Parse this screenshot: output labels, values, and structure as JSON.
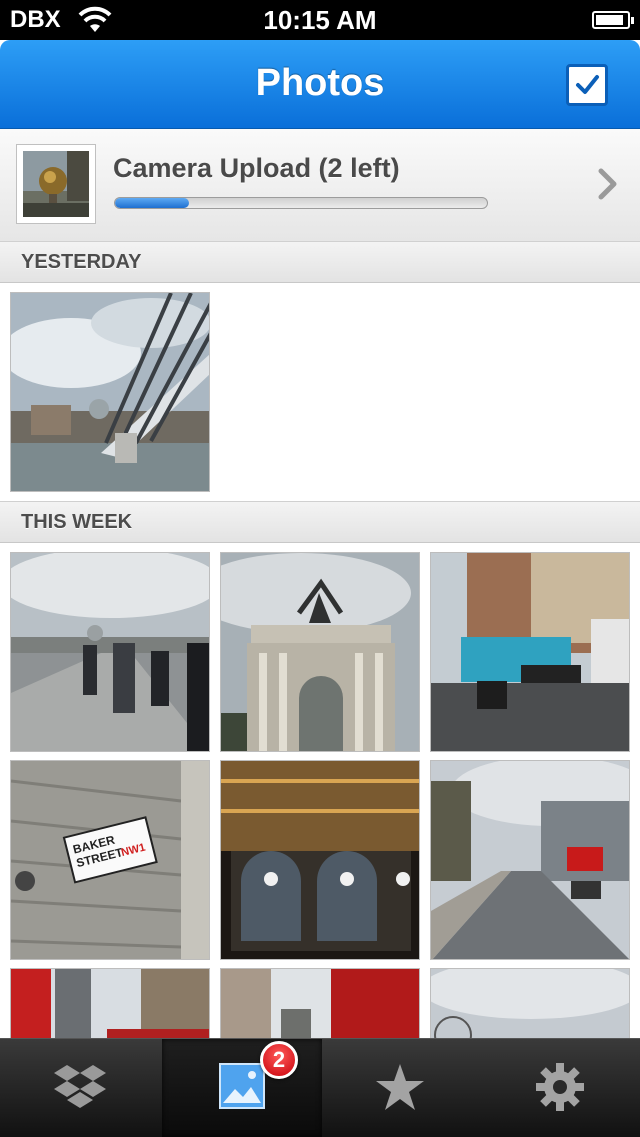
{
  "status_bar": {
    "carrier": "DBX",
    "time": "10:15 AM",
    "wifi_icon": "wifi-icon",
    "battery_level": 0.9
  },
  "nav": {
    "title": "Photos",
    "select_icon": "checkbox-icon"
  },
  "camera_upload": {
    "label": "Camera Upload (2 left)",
    "progress": 0.2,
    "chevron_icon": "chevron-right-icon"
  },
  "sections": [
    {
      "label": "YESTERDAY",
      "photos": [
        "bridge-photo"
      ]
    },
    {
      "label": "THIS WEEK",
      "photos": [
        "bridge-walkers-photo",
        "wellington-arch-photo",
        "street-bus-photo",
        "baker-street-sign-photo",
        "apple-store-photo",
        "street-view-photo",
        "red-bus-photo",
        "building-photo",
        "phone-box-photo",
        "london-eye-photo"
      ]
    }
  ],
  "tabs": [
    {
      "name": "dropbox",
      "icon": "dropbox-icon",
      "selected": false
    },
    {
      "name": "photos",
      "icon": "photos-icon",
      "selected": true,
      "badge": "2"
    },
    {
      "name": "favorites",
      "icon": "star-icon",
      "selected": false
    },
    {
      "name": "settings",
      "icon": "gear-icon",
      "selected": false
    }
  ],
  "colors": {
    "nav_blue": "#1a86ea",
    "progress_blue": "#2a7ad9",
    "badge_red": "#d8101a",
    "tabbar": "#222222"
  }
}
